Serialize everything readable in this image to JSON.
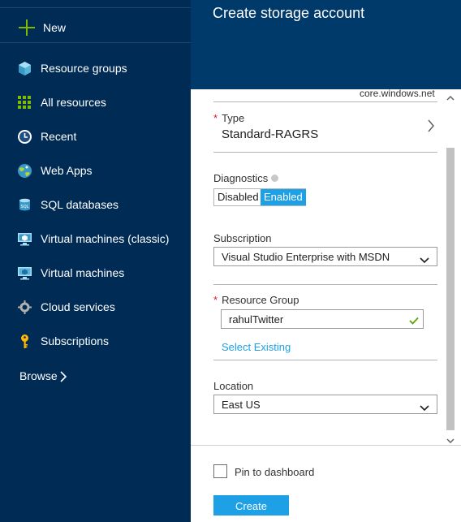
{
  "sidebar": {
    "new_label": "New",
    "items": [
      {
        "label": "Resource groups",
        "icon": "resource-groups-icon"
      },
      {
        "label": "All resources",
        "icon": "all-resources-grid-icon"
      },
      {
        "label": "Recent",
        "icon": "clock-icon"
      },
      {
        "label": "Web Apps",
        "icon": "web-apps-globe-icon"
      },
      {
        "label": "SQL databases",
        "icon": "sql-database-icon"
      },
      {
        "label": "Virtual machines (classic)",
        "icon": "virtual-machine-classic-icon"
      },
      {
        "label": "Virtual machines",
        "icon": "virtual-machine-icon"
      },
      {
        "label": "Cloud services",
        "icon": "cloud-services-icon"
      },
      {
        "label": "Subscriptions",
        "icon": "key-icon"
      }
    ],
    "browse_label": "Browse"
  },
  "blade": {
    "title": "Create storage account",
    "endpoint_suffix": "core.windows.net",
    "type": {
      "label": "Type",
      "value": "Standard-RAGRS"
    },
    "diagnostics": {
      "label": "Diagnostics",
      "disabled_label": "Disabled",
      "enabled_label": "Enabled",
      "selected": "Enabled"
    },
    "subscription": {
      "label": "Subscription",
      "value": "Visual Studio Enterprise with MSDN"
    },
    "resource_group": {
      "label": "Resource Group",
      "value": "rahulTwitter",
      "select_existing_link": "Select Existing"
    },
    "location": {
      "label": "Location",
      "value": "East US"
    },
    "pin_label": "Pin to dashboard",
    "create_label": "Create"
  },
  "colors": {
    "sidebar_bg": "#002b55",
    "header_bg": "#003a6b",
    "accent": "#1ea0e6",
    "new_plus": "#7fba00",
    "required": "#e81123",
    "valid_check": "#57a300"
  }
}
